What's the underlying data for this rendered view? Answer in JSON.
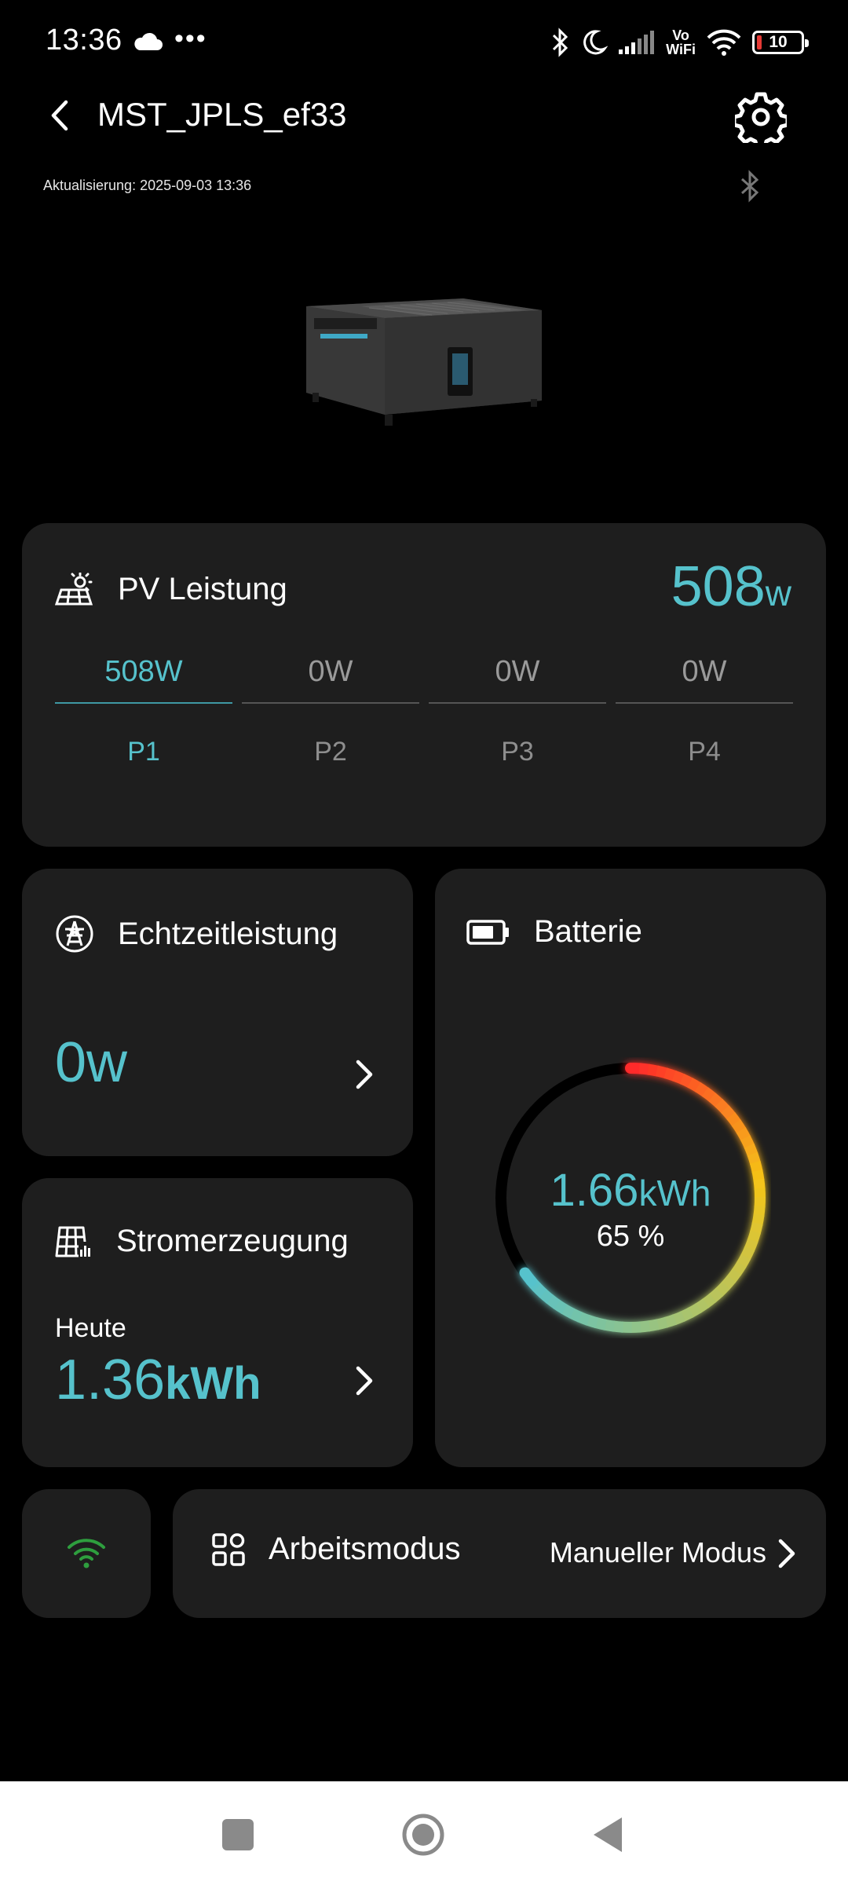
{
  "status_bar": {
    "time": "13:36",
    "more": "•••",
    "vowifi_top": "Vo",
    "vowifi_bottom": "WiFi",
    "battery_level": "10",
    "icons": [
      "cloud-icon",
      "bluetooth-icon",
      "moon-icon",
      "signal-icon",
      "vowifi-icon",
      "wifi-icon",
      "battery-icon"
    ]
  },
  "header": {
    "title": "MST_JPLS_ef33",
    "updated": "Aktualisierung: 2025-09-03 13:36"
  },
  "pv": {
    "label": "PV Leistung",
    "total_value": "508",
    "total_unit": "w",
    "tabs": [
      {
        "value": "508W",
        "name": "P1",
        "active": true
      },
      {
        "value": "0W",
        "name": "P2",
        "active": false
      },
      {
        "value": "0W",
        "name": "P3",
        "active": false
      },
      {
        "value": "0W",
        "name": "P4",
        "active": false
      }
    ]
  },
  "realtime": {
    "label": "Echtzeitleistung",
    "value": "0w"
  },
  "generation": {
    "label": "Stromerzeugung",
    "period": "Heute",
    "value": "1.36",
    "unit": "kWh"
  },
  "battery": {
    "label": "Batterie",
    "energy": "1.66",
    "energy_unit": "kWh",
    "percent_text": "65 %",
    "percent": 65
  },
  "work_mode": {
    "label": "Arbeitsmodus",
    "value": "Manueller Modus"
  },
  "colors": {
    "accent": "#56c2cc",
    "card": "#1e1e1e",
    "wifi_green": "#2e9e3e",
    "ring_start": "#ff2a2a",
    "ring_mid": "#f5c518",
    "ring_end": "#56c2cc"
  }
}
